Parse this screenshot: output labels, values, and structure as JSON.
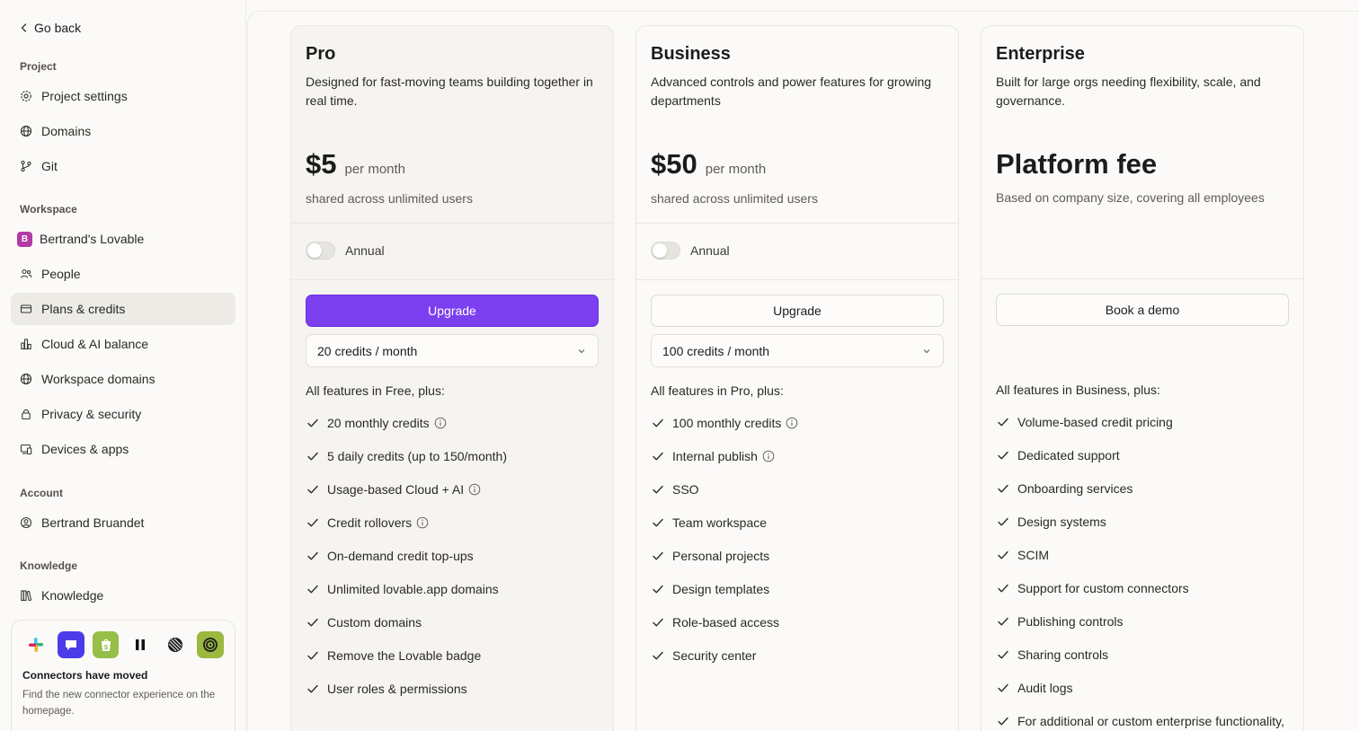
{
  "sidebar": {
    "go_back": "Go back",
    "project_label": "Project",
    "project_items": [
      "Project settings",
      "Domains",
      "Git"
    ],
    "workspace_label": "Workspace",
    "workspace_badge": "B",
    "workspace_items": [
      "Bertrand's Lovable",
      "People",
      "Plans & credits",
      "Cloud & AI balance",
      "Workspace domains",
      "Privacy & security",
      "Devices & apps"
    ],
    "active_item": "Plans & credits",
    "account_label": "Account",
    "account_items": [
      "Bertrand Bruandet"
    ],
    "knowledge_label": "Knowledge",
    "knowledge_items": [
      "Knowledge"
    ],
    "connectors": {
      "icons": [
        "slack-icon",
        "chat-app-icon",
        "shopify-icon",
        "pause-bars-icon",
        "linear-icon",
        "spiral-app-icon"
      ],
      "title": "Connectors have moved",
      "desc": "Find the new connector experience on the homepage."
    }
  },
  "plans": {
    "pro": {
      "name": "Pro",
      "desc": "Designed for fast-moving teams building together in real time.",
      "price": "$5",
      "per": "per month",
      "sub": "shared across unlimited users",
      "toggle_label": "Annual",
      "button": "Upgrade",
      "select": "20 credits / month",
      "features_title": "All features in Free, plus:",
      "features": [
        "20 monthly credits",
        "5 daily credits (up to 150/month)",
        "Usage-based Cloud + AI",
        "Credit rollovers",
        "On-demand credit top-ups",
        "Unlimited lovable.app domains",
        "Custom domains",
        "Remove the Lovable badge",
        "User roles & permissions"
      ]
    },
    "business": {
      "name": "Business",
      "desc": "Advanced controls and power features for growing departments",
      "price": "$50",
      "per": "per month",
      "sub": "shared across unlimited users",
      "toggle_label": "Annual",
      "button": "Upgrade",
      "select": "100 credits / month",
      "features_title": "All features in Pro, plus:",
      "features": [
        "100 monthly credits",
        "Internal publish",
        "SSO",
        "Team workspace",
        "Personal projects",
        "Design templates",
        "Role-based access",
        "Security center"
      ]
    },
    "enterprise": {
      "name": "Enterprise",
      "desc": "Built for large orgs needing flexibility, scale, and governance.",
      "price": "Platform fee",
      "sub": "Based on company size, covering all employees",
      "button": "Book a demo",
      "features_title": "All features in Business, plus:",
      "features": [
        "Volume-based credit pricing",
        "Dedicated support",
        "Onboarding services",
        "Design systems",
        "SCIM",
        "Support for custom connectors",
        "Publishing controls",
        "Sharing controls",
        "Audit logs",
        "For additional or custom enterprise functionality,"
      ]
    }
  },
  "colors": {
    "accent": "#7b3ff0",
    "workspace_badge": "#b23aa5",
    "active_nav": "#ecebe6"
  }
}
